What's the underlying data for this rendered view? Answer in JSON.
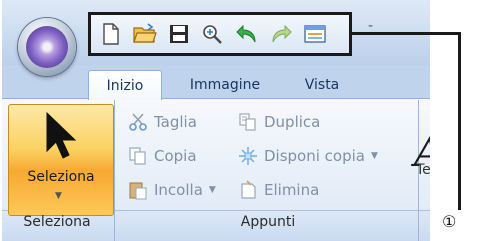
{
  "window": {
    "title_mark": "-"
  },
  "tabs": [
    {
      "label": "Inizio",
      "selected": true
    },
    {
      "label": "Immagine",
      "selected": false
    },
    {
      "label": "Vista",
      "selected": false
    }
  ],
  "quick_access": {
    "icons": [
      "new-file-icon",
      "open-folder-icon",
      "save-icon",
      "zoom-icon",
      "undo-icon",
      "redo-icon",
      "layout-icon"
    ]
  },
  "ribbon": {
    "seleziona_group": {
      "button_label": "Seleziona",
      "group_label": "Seleziona"
    },
    "appunti_group": {
      "group_label": "Appunti",
      "commands": {
        "taglia": "Taglia",
        "copia": "Copia",
        "incolla": "Incolla",
        "duplica": "Duplica",
        "disponi_copia": "Disponi copia",
        "elimina": "Elimina"
      }
    },
    "next_group": {
      "big_text": "A",
      "label_partial": "Te"
    }
  },
  "callout": {
    "number": "①"
  },
  "colors": {
    "accent_selected": "#f7a832",
    "callout_line": "#1a1a1a",
    "disabled_text": "#8090a6"
  }
}
